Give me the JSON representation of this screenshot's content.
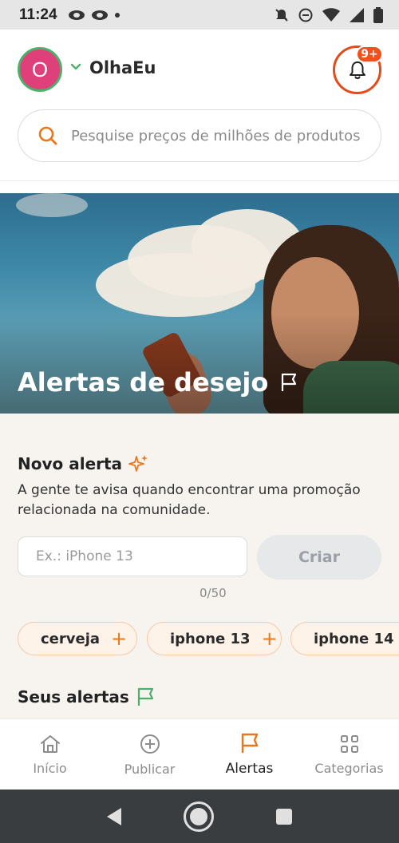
{
  "status_bar": {
    "time": "11:24",
    "icons": [
      "eye-icon",
      "eye-icon",
      "dot-icon",
      "silent-icon",
      "dnd-icon",
      "wifi-icon",
      "signal-icon",
      "battery-icon"
    ]
  },
  "header": {
    "avatar_initial": "O",
    "username": "OlhaEu",
    "notification_badge": "9+",
    "search_placeholder": "Pesquise preços de milhões de produtos"
  },
  "hero": {
    "title": "Alertas de desejo"
  },
  "new_alert": {
    "title": "Novo alerta",
    "description": "A gente te avisa quando encontrar uma promoção relacionada na comunidade.",
    "input_placeholder": "Ex.: iPhone 13",
    "create_label": "Criar",
    "counter": "0/50",
    "suggestions": [
      {
        "label": "cerveja"
      },
      {
        "label": "iphone 13"
      },
      {
        "label": "iphone 14"
      }
    ]
  },
  "your_alerts": {
    "title": "Seus alertas"
  },
  "bottom_nav": {
    "items": [
      {
        "label": "Início",
        "icon": "home-icon",
        "active": false
      },
      {
        "label": "Publicar",
        "icon": "plus-circle-icon",
        "active": false
      },
      {
        "label": "Alertas",
        "icon": "flag-icon",
        "active": true
      },
      {
        "label": "Categorias",
        "icon": "grid-icon",
        "active": false
      }
    ]
  },
  "colors": {
    "accent": "#e8781e",
    "notification": "#f2511b",
    "avatar": "#e0407a",
    "success": "#4caf6a",
    "content_bg": "#f7f4ef"
  }
}
